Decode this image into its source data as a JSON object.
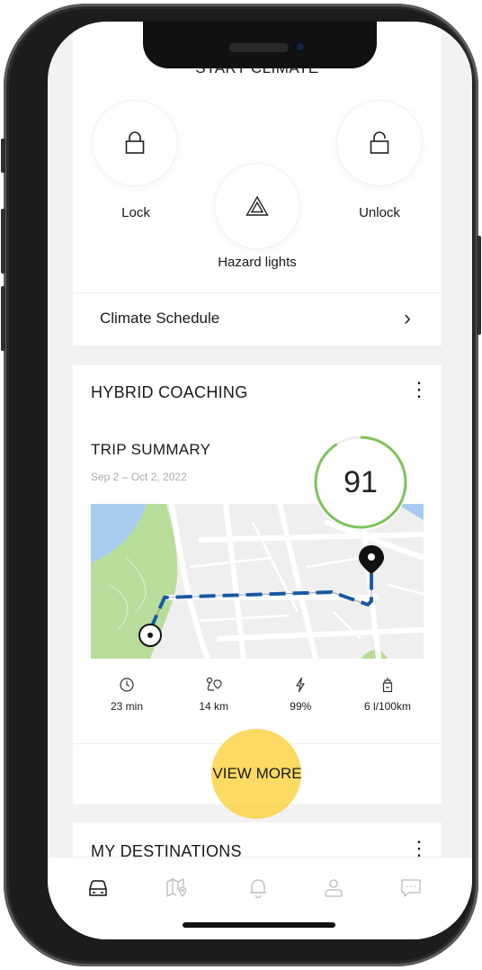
{
  "climate": {
    "caption": "START CLIMATE",
    "lock_label": "Lock",
    "hazard_label": "Hazard lights",
    "unlock_label": "Unlock",
    "schedule_label": "Climate Schedule"
  },
  "coaching": {
    "title": "HYBRID COACHING",
    "trip_title": "TRIP SUMMARY",
    "trip_date": "Sep 2 – Oct 2, 2022",
    "score": "91",
    "score_fraction": 0.91,
    "stats": [
      {
        "icon": "clock-icon",
        "value": "23 min"
      },
      {
        "icon": "route-icon",
        "value": "14 km"
      },
      {
        "icon": "lightning-icon",
        "value": "99%"
      },
      {
        "icon": "fuel-icon",
        "value": "6 l/100km"
      }
    ],
    "view_more_label": "VIEW MORE"
  },
  "destinations": {
    "title": "MY DESTINATIONS"
  },
  "tabs": [
    {
      "icon": "car-icon",
      "active": true
    },
    {
      "icon": "map-icon",
      "active": false
    },
    {
      "icon": "bell-icon",
      "active": false
    },
    {
      "icon": "user-icon",
      "active": false
    },
    {
      "icon": "chat-icon",
      "active": false
    }
  ],
  "colors": {
    "score_ring": "#7dc35a",
    "route": "#1a5fb4",
    "tap_highlight": "#fcd448",
    "map_park": "#b8dd9b",
    "map_water": "#a8ccf0"
  }
}
